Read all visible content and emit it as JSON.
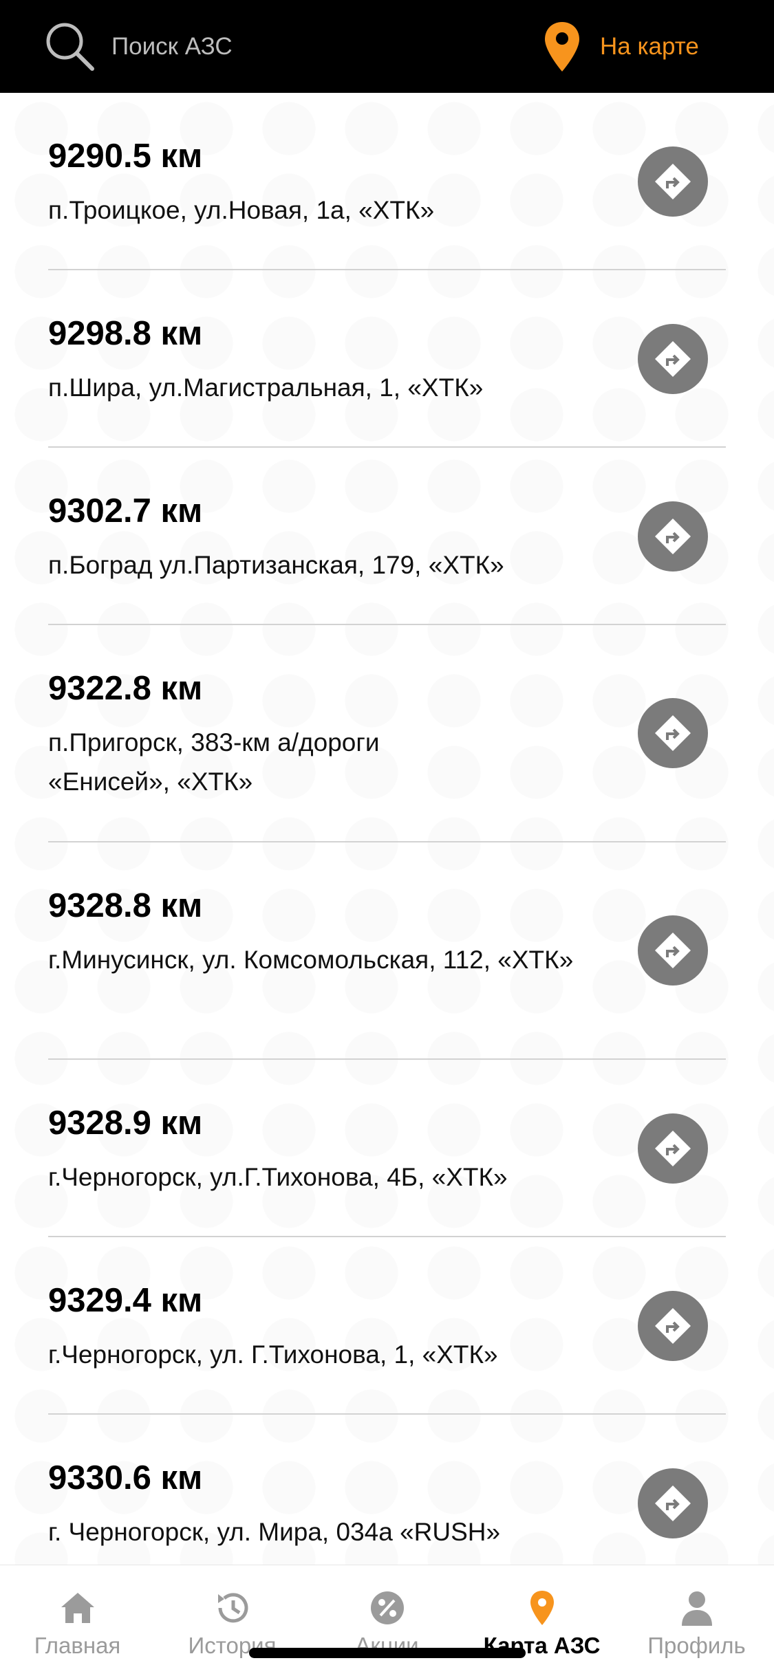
{
  "header": {
    "search_placeholder": "Поиск АЗС",
    "map_button_label": "На карте",
    "accent_color": "#f7941d"
  },
  "stations": [
    {
      "distance": "9290.5 км",
      "address": "п.Троицкое, ул.Новая, 1а, «ХТК»"
    },
    {
      "distance": "9298.8 км",
      "address": "п.Шира, ул.Магистральная, 1, «ХТК»"
    },
    {
      "distance": "9302.7 км",
      "address": "п.Боград ул.Партизанская, 179, «ХТК»"
    },
    {
      "distance": "9322.8 км",
      "address": "п.Пригорск, 383-км а/дороги «Енисей», «ХТК»"
    },
    {
      "distance": "9328.8 км",
      "address": "г.Минусинск, ул. Комсомольская, 112, «ХТК»"
    },
    {
      "distance": "9328.9 км",
      "address": "г.Черногорск, ул.Г.Тихонова, 4Б, «ХТК»"
    },
    {
      "distance": "9329.4 км",
      "address": "г.Черногорск, ул. Г.Тихонова, 1, «ХТК»"
    },
    {
      "distance": "9330.6 км",
      "address": "г. Черногорск, ул. Мира, 034а «RUSH»"
    }
  ],
  "tabbar": {
    "tabs": [
      {
        "label": "Главная",
        "icon": "home-icon"
      },
      {
        "label": "История",
        "icon": "history-icon"
      },
      {
        "label": "Акции",
        "icon": "percent-badge-icon"
      },
      {
        "label": "Карта АЗС",
        "icon": "map-pin-icon",
        "active": true
      },
      {
        "label": "Профиль",
        "icon": "user-icon"
      }
    ],
    "active_color": "#f7941d",
    "inactive_color": "#9b9b9b"
  }
}
